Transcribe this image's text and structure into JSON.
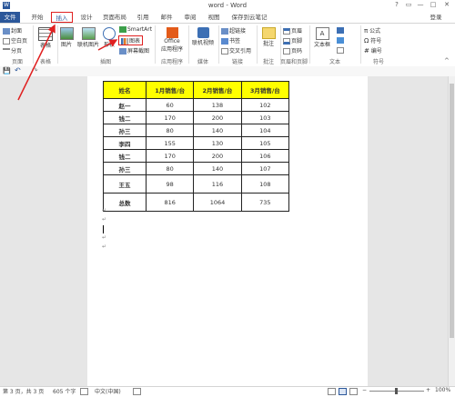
{
  "window": {
    "title": "word - Word",
    "help": "?",
    "restore": "▭",
    "minimize": "—",
    "maximize": "□",
    "close": "✕"
  },
  "tabs": [
    {
      "label": "文件"
    },
    {
      "label": "开始"
    },
    {
      "label": "插入"
    },
    {
      "label": "设计"
    },
    {
      "label": "页面布局"
    },
    {
      "label": "引用"
    },
    {
      "label": "邮件"
    },
    {
      "label": "审阅"
    },
    {
      "label": "视图"
    },
    {
      "label": "保存到云笔记"
    }
  ],
  "account": "登录",
  "ribbon": {
    "pages": {
      "cover": "封面",
      "blank": "空白页",
      "break": "分页",
      "label": "页面"
    },
    "tables": {
      "table": "表格",
      "label": "表格"
    },
    "illustrations": {
      "picture": "图片",
      "online_picture": "联机图片",
      "shapes": "形状",
      "smartart": "SmartArt",
      "chart": "图表",
      "screenshot": "屏幕截图",
      "label": "插图"
    },
    "apps": {
      "office": "Office",
      "apps_for_office": "应用程序",
      "label": "应用程序"
    },
    "media": {
      "online_video": "联机视频",
      "label": "媒体"
    },
    "links": {
      "hyperlink": "超链接",
      "bookmark": "书签",
      "cross_ref": "交叉引用",
      "label": "链接"
    },
    "comments": {
      "comment": "批注",
      "label": "批注"
    },
    "header_footer": {
      "header": "页眉",
      "footer": "页脚",
      "page_number": "页码",
      "label": "页眉和页脚"
    },
    "text": {
      "textbox": "文本框",
      "label": "文本"
    },
    "symbols": {
      "equation": "公式",
      "symbol": "符号",
      "number": "编号",
      "label": "符号"
    }
  },
  "qat": {
    "save": "💾",
    "undo": "↶",
    "redo": "↷"
  },
  "table": {
    "headers": [
      "姓名",
      "1月销售/台",
      "2月销售/台",
      "3月销售/台"
    ],
    "rows": [
      {
        "name": "赵一",
        "m1": "60",
        "m2": "138",
        "m3": "102"
      },
      {
        "name": "钱二",
        "m1": "170",
        "m2": "200",
        "m3": "103"
      },
      {
        "name": "孙三",
        "m1": "80",
        "m2": "140",
        "m3": "104"
      },
      {
        "name": "李四",
        "m1": "155",
        "m2": "130",
        "m3": "105"
      },
      {
        "name": "钱二",
        "m1": "170",
        "m2": "200",
        "m3": "106"
      },
      {
        "name": "孙三",
        "m1": "80",
        "m2": "140",
        "m3": "107"
      },
      {
        "name": "王五",
        "m1": "98",
        "m2": "116",
        "m3": "108"
      },
      {
        "name": "总数",
        "m1": "816",
        "m2": "1064",
        "m3": "735"
      }
    ]
  },
  "status": {
    "page": "第 3 页，共 3 页",
    "words": "605 个字",
    "lang": "中文(中国)",
    "zoom": "100%",
    "zoom_minus": "−",
    "zoom_plus": "+"
  },
  "colors": {
    "accent": "#2b579a",
    "highlight": "#ffff00",
    "annotation": "#e02020"
  }
}
